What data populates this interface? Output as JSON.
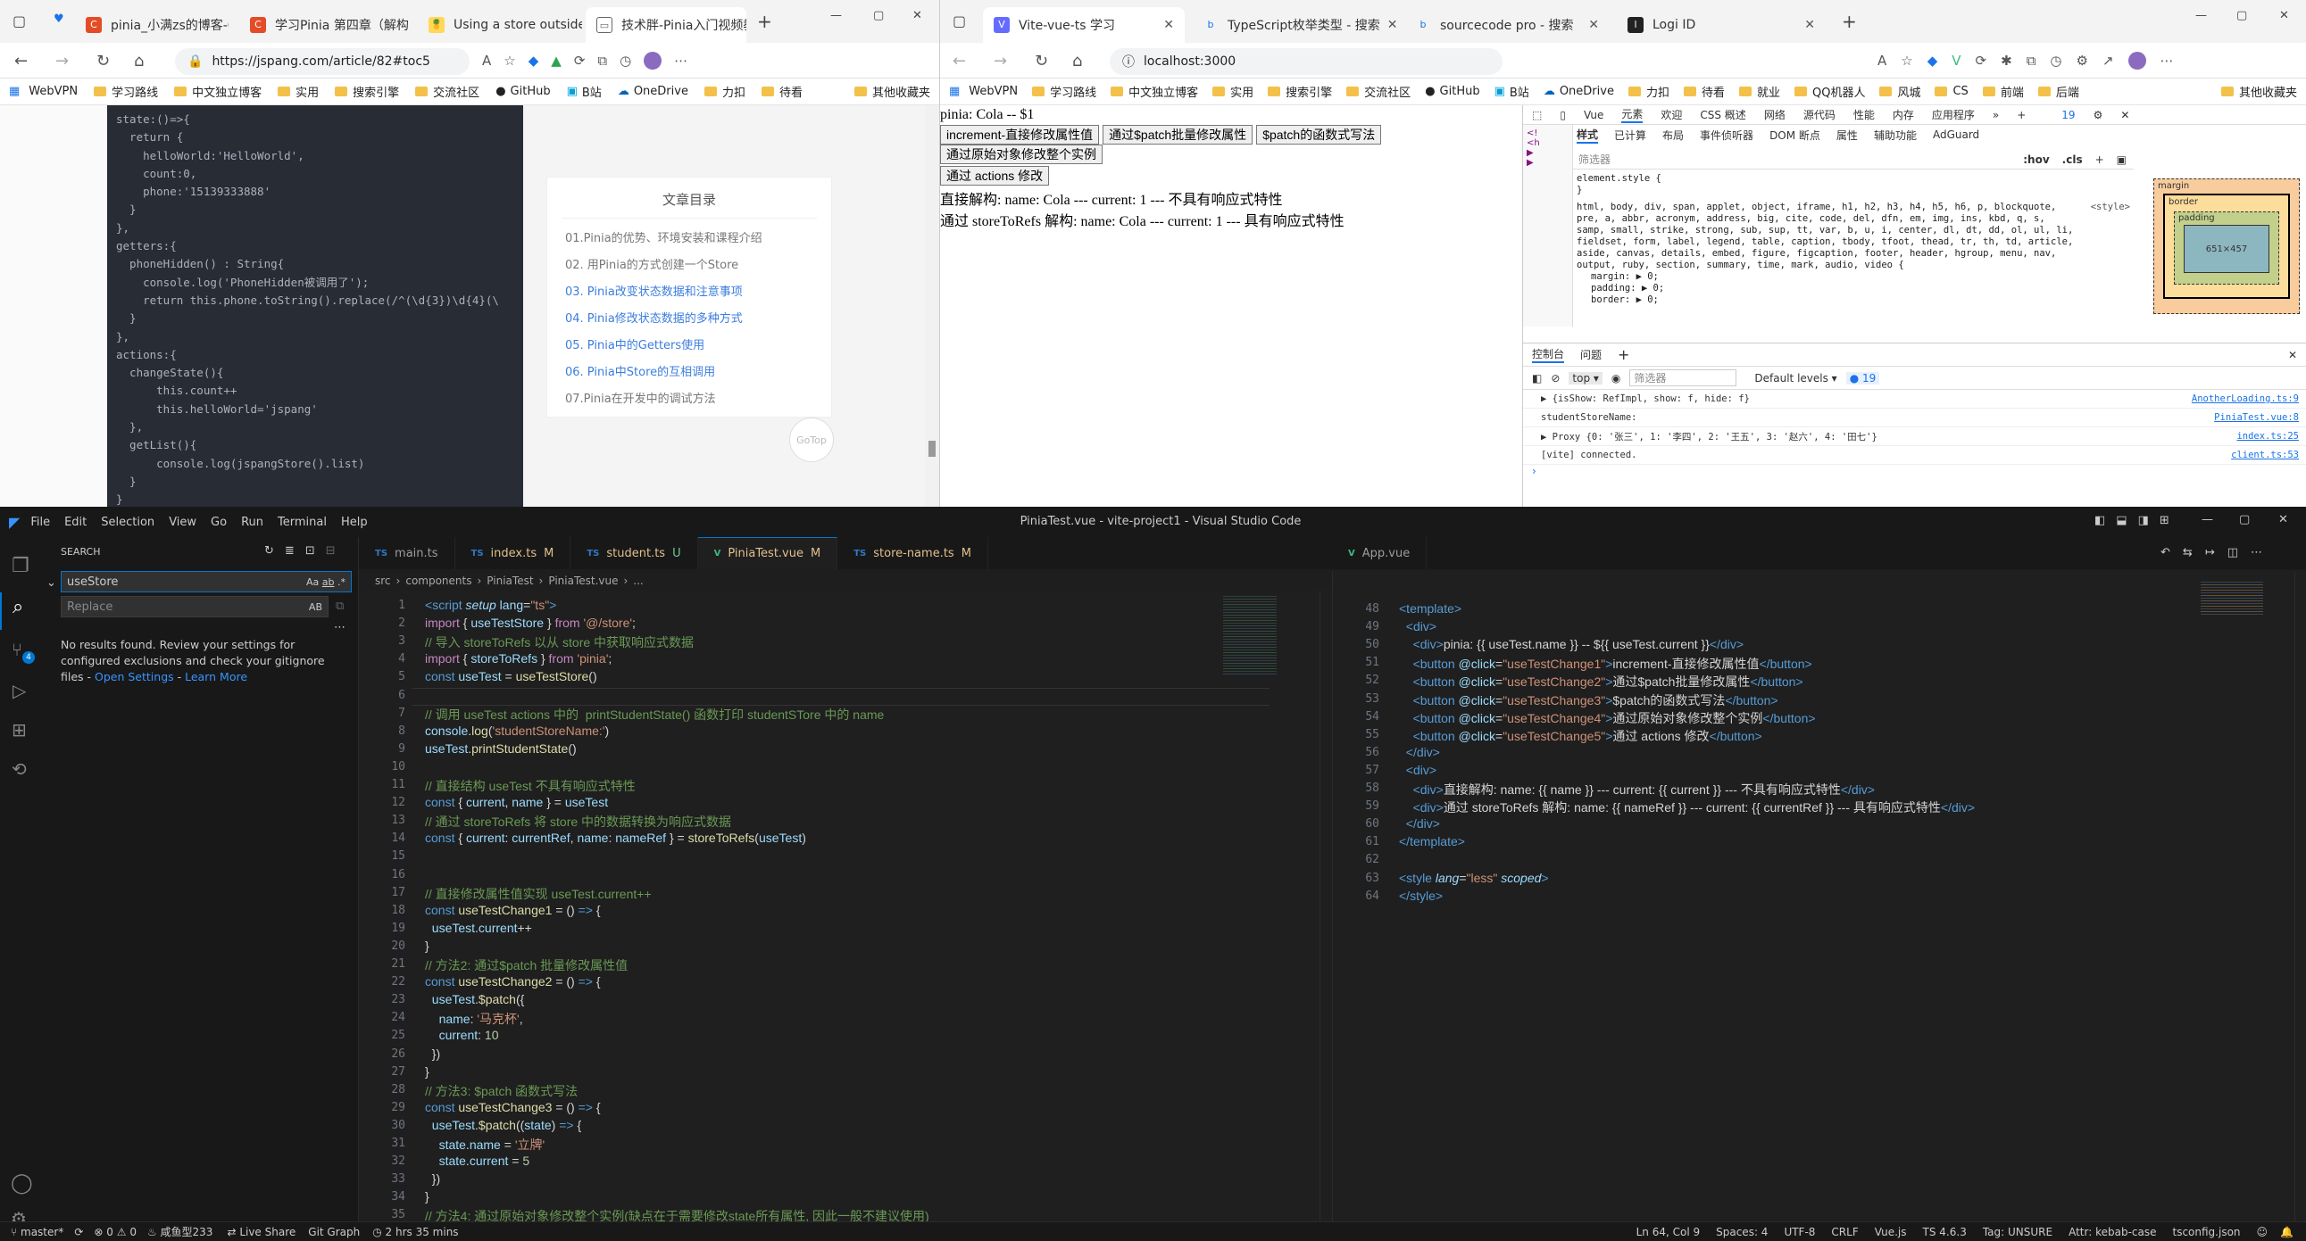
{
  "left_browser": {
    "tabs": [
      "pinia_小满zs的博客-CS",
      "学习Pinia 第四章（解构",
      "Using a store outside o",
      "技术胖-Pinia入门视频教"
    ],
    "url": "https://jspang.com/article/82#toc5",
    "bookmarks": [
      "WebVPN",
      "学习路线",
      "中文独立博客",
      "实用",
      "搜索引擎",
      "交流社区",
      "GitHub",
      "B站",
      "OneDrive",
      "力扣",
      "待看"
    ],
    "bookmarks_other": "其他收藏夹",
    "code_lines": [
      "state:()=>{",
      "  return {",
      "    helloWorld:'HelloWorld',",
      "    count:0,",
      "    phone:'15139333888'",
      "  }",
      "},",
      "getters:{",
      "  phoneHidden() : String{",
      "    console.log('PhoneHidden被调用了');",
      "    return this.phone.toString().replace(/^(\\d{3})\\d{4}(\\",
      "  }",
      "},",
      "actions:{",
      "  changeState(){",
      "      this.count++",
      "      this.helloWorld='jspang'",
      "  },",
      "  getList(){",
      "      console.log(jspangStore().list)",
      "  }",
      "}"
    ],
    "toc_title": "文章目录",
    "toc_items": [
      "01.Pinia的优势、环境安装和课程介绍",
      "02. 用Pinia的方式创建一个Store",
      "03. Pinia改变状态数据和注意事项",
      "04. Pinia修改状态数据的多种方式",
      "05. Pinia中的Getters使用",
      "06. Pinia中Store的互相调用",
      "07.Pinia在开发中的调试方法"
    ],
    "gotop": "GoTop"
  },
  "right_browser": {
    "tabs": [
      "Vite-vue-ts 学习",
      "TypeScript枚举类型 - 搜索",
      "sourcecode pro - 搜索",
      "Logi ID"
    ],
    "url": "localhost:3000",
    "bookmarks": [
      "WebVPN",
      "学习路线",
      "中文独立博客",
      "实用",
      "搜索引擎",
      "交流社区",
      "GitHub",
      "B站",
      "OneDrive",
      "力扣",
      "待看",
      "就业",
      "QQ机器人",
      "风城",
      "CS",
      "前端",
      "后端"
    ],
    "bookmarks_other": "其他收藏夹",
    "page_title": "pinia: Cola -- $1",
    "buttons": [
      "increment-直接修改属性值",
      "通过$patch批量修改属性",
      "$patch的函数式写法",
      "通过原始对象修改整个实例",
      "通过 actions 修改"
    ],
    "line1": "直接解构: name: Cola --- current: 1 --- 不具有响应式特性",
    "line2": "通过 storeToRefs 解构: name: Cola --- current: 1 --- 具有响应式特性",
    "devtools": {
      "top_tabs": [
        "Vue",
        "元素",
        "欢迎",
        "CSS 概述",
        "网络",
        "源代码",
        "性能",
        "内存",
        "应用程序"
      ],
      "badge": "19",
      "sub_tabs": [
        "样式",
        "已计算",
        "布局",
        "事件侦听器",
        "DOM 断点",
        "属性",
        "辅助功能",
        "AdGuard"
      ],
      "filter": "筛选器",
      "hov": ":hov",
      "cls": ".cls",
      "element_style": "element.style {",
      "ua_selector": "html, body, div, span, applet, object, iframe, h1, h2, h3, h4, h5, h6, p, blockquote, pre, a, abbr, acronym, address, big, cite, code, del, dfn, em, img, ins, kbd, q, s, samp, small, strike, strong, sub, sup, tt, var, b, u, i, center, dl, dt, dd, ol, ul, li, fieldset, form, label, legend, table, caption, tbody, tfoot, thead, tr, th, td, article, aside, canvas, details, embed, figure, figcaption, footer, header, hgroup, menu, nav, output, ruby, section, summary, time, mark, audio, video {",
      "ua_origin": "<style>",
      "props": [
        "margin: ▶ 0;",
        "padding: ▶ 0;",
        "border: ▶ 0;"
      ],
      "box": {
        "margin": "margin",
        "border": "border",
        "padding": "padding",
        "content": "651×457"
      },
      "console_tabs": [
        "控制台",
        "问题"
      ],
      "context": "top",
      "levels": "Default levels",
      "console_badge": "19",
      "logs": [
        {
          "text": "▶ {isShow: RefImpl, show: f, hide: f}",
          "src": "AnotherLoading.ts:9"
        },
        {
          "text": "studentStoreName:",
          "src": "PiniaTest.vue:8"
        },
        {
          "text": "▶ Proxy {0: '张三', 1: '李四', 2: '王五', 3: '赵六', 4: '田七'}",
          "src": "index.ts:25"
        },
        {
          "text": "[vite] connected.",
          "src": "client.ts:53"
        }
      ]
    }
  },
  "vscode": {
    "menu": [
      "File",
      "Edit",
      "Selection",
      "View",
      "Go",
      "Run",
      "Terminal",
      "Help"
    ],
    "title": "PiniaTest.vue - vite-project1 - Visual Studio Code",
    "search_title": "SEARCH",
    "search_value": "useStore",
    "replace_placeholder": "Replace",
    "no_results": "No results found. Review your settings for configured exclusions and check your gitignore files - ",
    "open_settings": "Open Settings",
    "learn_more": "Learn More",
    "tabs_left": [
      {
        "icon": "TS",
        "name": "main.ts",
        "mod": ""
      },
      {
        "icon": "TS",
        "name": "index.ts",
        "mod": "M"
      },
      {
        "icon": "TS",
        "name": "student.ts",
        "mod": "U"
      },
      {
        "icon": "V",
        "name": "PiniaTest.vue",
        "mod": "M"
      },
      {
        "icon": "TS",
        "name": "store-name.ts",
        "mod": "M"
      }
    ],
    "tabs_right": [
      {
        "icon": "V",
        "name": "App.vue",
        "mod": ""
      }
    ],
    "breadcrumb": [
      "src",
      "components",
      "PiniaTest",
      "PiniaTest.vue",
      "..."
    ],
    "status": {
      "branch": "master*",
      "errors": "0",
      "warnings": "0",
      "fish": "咸鱼型233",
      "live": "Live Share",
      "graph": "Git Graph",
      "time": "2 hrs 35 mins",
      "pos": "Ln 64, Col 9",
      "spaces": "Spaces: 4",
      "enc": "UTF-8",
      "eol": "CRLF",
      "lang": "Vue.js",
      "ts": "TS 4.6.3",
      "tag": "Tag: UNSURE",
      "attr": "Attr: kebab-case",
      "tsconfig": "tsconfig.json"
    }
  },
  "colors": {
    "vscode_accent": "#0078d4",
    "link": "#3794ff"
  }
}
